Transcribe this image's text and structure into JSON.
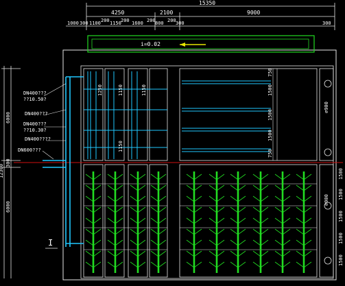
{
  "drawing": {
    "dims_top_total": "15350",
    "dims_top": [
      "4250",
      "2100",
      "9000"
    ],
    "dims_top_small": [
      "1000",
      "300",
      "1100",
      "200",
      "1150",
      "200",
      "1600",
      "200",
      "800",
      "200",
      "300",
      "300"
    ],
    "slope_label": "i=0.02",
    "right_dims_upper": [
      "750",
      "1500",
      "1500",
      "1500",
      "750"
    ],
    "right_dims_lower": [
      "1500",
      "1500",
      "1500",
      "1500",
      "1500"
    ],
    "right_circle_labels": [
      "⌀900",
      "⌀900"
    ],
    "left_dims": [
      "6000",
      "12300",
      "300",
      "6000"
    ],
    "left_pipe_labels": [
      "DN400???",
      "??10.50?",
      "DN400???",
      "DN400???",
      "??10.30?",
      "DN400????",
      "DN600???"
    ],
    "bay_labels": [
      "1250",
      "1150",
      "1150",
      "1150"
    ],
    "marker": "I",
    "colors": {
      "frame": "#e8e8e8",
      "green": "#22dd22",
      "cyan": "#20c8ff",
      "red": "#d01010",
      "yellow": "#e6e600",
      "text": "#ffffff"
    }
  }
}
